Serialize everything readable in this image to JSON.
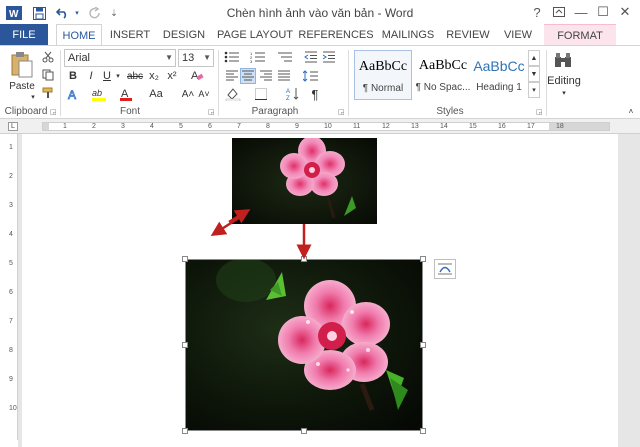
{
  "window": {
    "title": "Chèn hình ảnh vào văn bản - Word",
    "help": "?",
    "restore": "⧉",
    "minimize": "—",
    "maximize": "☐",
    "close": "✕"
  },
  "quick_access": {
    "app_icon": "W",
    "save_icon": "save-icon",
    "undo_icon": "undo-icon",
    "redo_icon": "redo-icon",
    "customize_icon": "customize-icon"
  },
  "tabs": [
    {
      "label": "FILE"
    },
    {
      "label": "HOME"
    },
    {
      "label": "INSERT"
    },
    {
      "label": "DESIGN"
    },
    {
      "label": "PAGE LAYOUT"
    },
    {
      "label": "REFERENCES"
    },
    {
      "label": "MAILINGS"
    },
    {
      "label": "REVIEW"
    },
    {
      "label": "VIEW"
    },
    {
      "label": "FORMAT"
    }
  ],
  "ribbon": {
    "clipboard": {
      "label": "Clipboard",
      "paste": "Paste"
    },
    "font": {
      "label": "Font",
      "name": "Arial",
      "size": "13",
      "bold": "B",
      "italic": "I",
      "underline": "U",
      "strike": "abc",
      "subscript": "x₂",
      "superscript": "x²",
      "grow": "A˄",
      "shrink": "A˅",
      "case": "Aa",
      "highlight": "ab",
      "color": "A"
    },
    "paragraph": {
      "label": "Paragraph"
    },
    "styles": {
      "label": "Styles",
      "items": [
        {
          "preview": "AaBbCc",
          "name": "¶ Normal"
        },
        {
          "preview": "AaBbCc",
          "name": "¶ No Spac..."
        },
        {
          "preview": "AaBbCc",
          "name": "Heading 1"
        }
      ]
    },
    "editing": {
      "label": "Editing"
    }
  },
  "ruler": {
    "numbers": [
      "1",
      "2",
      "3",
      "4",
      "5",
      "6",
      "7",
      "8",
      "9",
      "10",
      "11",
      "12",
      "13",
      "14",
      "15",
      "16",
      "17",
      "18"
    ],
    "vertical": [
      "1",
      "2",
      "3",
      "4",
      "5",
      "6",
      "7",
      "8",
      "9",
      "10"
    ]
  },
  "colors": {
    "file_tab": "#2b579a",
    "accent": "#2b579a",
    "format_tab": "#fce4ec",
    "arrow": "#c0201e",
    "petal": "#f090b8",
    "petal_center": "#d21e4a",
    "leaf": "#4caf2a"
  }
}
